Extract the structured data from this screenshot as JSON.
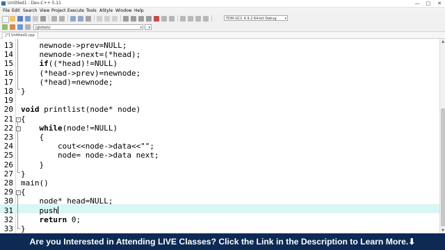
{
  "window": {
    "title": "Untitled1 - Dev-C++ 5.11",
    "controls": [
      "—",
      "□",
      "✕"
    ]
  },
  "menu": [
    "File",
    "Edit",
    "Search",
    "View",
    "Project",
    "Execute",
    "Tools",
    "AStyle",
    "Window",
    "Help"
  ],
  "toolbar": {
    "compiler_select": "TDM-GCC 4.9.2 64-bit Debug",
    "scope_select": "(globals)"
  },
  "tabs": [
    "[*] Untitled1.cpp"
  ],
  "editor": {
    "current_line": 31,
    "lines": [
      {
        "num": "13",
        "text": "    newnode->prev=NULL;"
      },
      {
        "num": "14",
        "text": "    newnode->next=(*head);"
      },
      {
        "num": "15",
        "text": "    if((*head)!=NULL)"
      },
      {
        "num": "16",
        "text": "    (*head->prev)=newnode;"
      },
      {
        "num": "17",
        "text": "    (*head)=newnode;"
      },
      {
        "num": "18",
        "text": "}"
      },
      {
        "num": "19",
        "text": ""
      },
      {
        "num": "20",
        "text": "void printlist(node* node)"
      },
      {
        "num": "21",
        "text": "{"
      },
      {
        "num": "22",
        "text": "    while(node!=NULL)"
      },
      {
        "num": "23",
        "text": "    {"
      },
      {
        "num": "24",
        "text": "        cout<<node->data<<\"\";"
      },
      {
        "num": "25",
        "text": "        node= node->data next;"
      },
      {
        "num": "26",
        "text": "    }"
      },
      {
        "num": "27",
        "text": "}"
      },
      {
        "num": "28",
        "text": "main()"
      },
      {
        "num": "29",
        "text": "{"
      },
      {
        "num": "30",
        "text": "    node* head=NULL;"
      },
      {
        "num": "31",
        "text": "    push"
      },
      {
        "num": "32",
        "text": "    return 0;"
      },
      {
        "num": "33",
        "text": "}"
      }
    ]
  },
  "banner": {
    "text": "Are you Interested in Attending LIVE Classes? Click the Link in the Description to Learn More.⬇"
  },
  "colors": {
    "current_line_bg": "#d8f6f4",
    "banner_bg": "#0d2a55",
    "banner_text": "#ffffff"
  }
}
